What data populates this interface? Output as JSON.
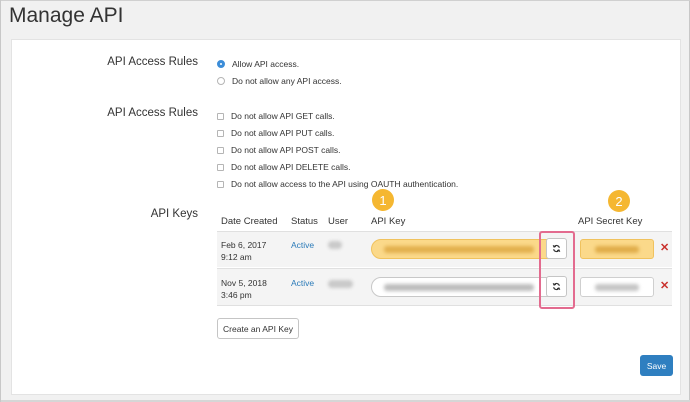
{
  "page": {
    "title": "Manage API"
  },
  "access_rules": {
    "label": "API Access Rules",
    "options": [
      {
        "label": "Allow API access.",
        "selected": true
      },
      {
        "label": "Do not allow any API access.",
        "selected": false
      }
    ]
  },
  "call_rules": {
    "label": "API Access Rules",
    "options": [
      {
        "label": "Do not allow API GET calls.",
        "checked": false
      },
      {
        "label": "Do not allow API PUT calls.",
        "checked": false
      },
      {
        "label": "Do not allow API POST calls.",
        "checked": false
      },
      {
        "label": "Do not allow API DELETE calls.",
        "checked": false
      },
      {
        "label": "Do not allow access to the API using OAUTH authentication.",
        "checked": false
      }
    ]
  },
  "api_keys": {
    "label": "API Keys",
    "columns": [
      "Date Created",
      "Status",
      "User",
      "API Key",
      "API Secret Key"
    ],
    "rows": [
      {
        "date": "Feb 6, 2017",
        "time": "9:12 am",
        "status": "Active"
      },
      {
        "date": "Nov 5, 2018",
        "time": "3:46 pm",
        "status": "Active"
      }
    ],
    "create_label": "Create an API Key"
  },
  "actions": {
    "save_label": "Save"
  },
  "callouts": [
    "1",
    "2"
  ],
  "colors": {
    "accent": "#2f7fc0",
    "highlight": "#fbd98a",
    "callout_badge": "#f5b731",
    "callout_box": "#e36b8f",
    "delete": "#c9302c"
  },
  "icons": {
    "refresh": "refresh-icon",
    "delete": "close-icon"
  }
}
